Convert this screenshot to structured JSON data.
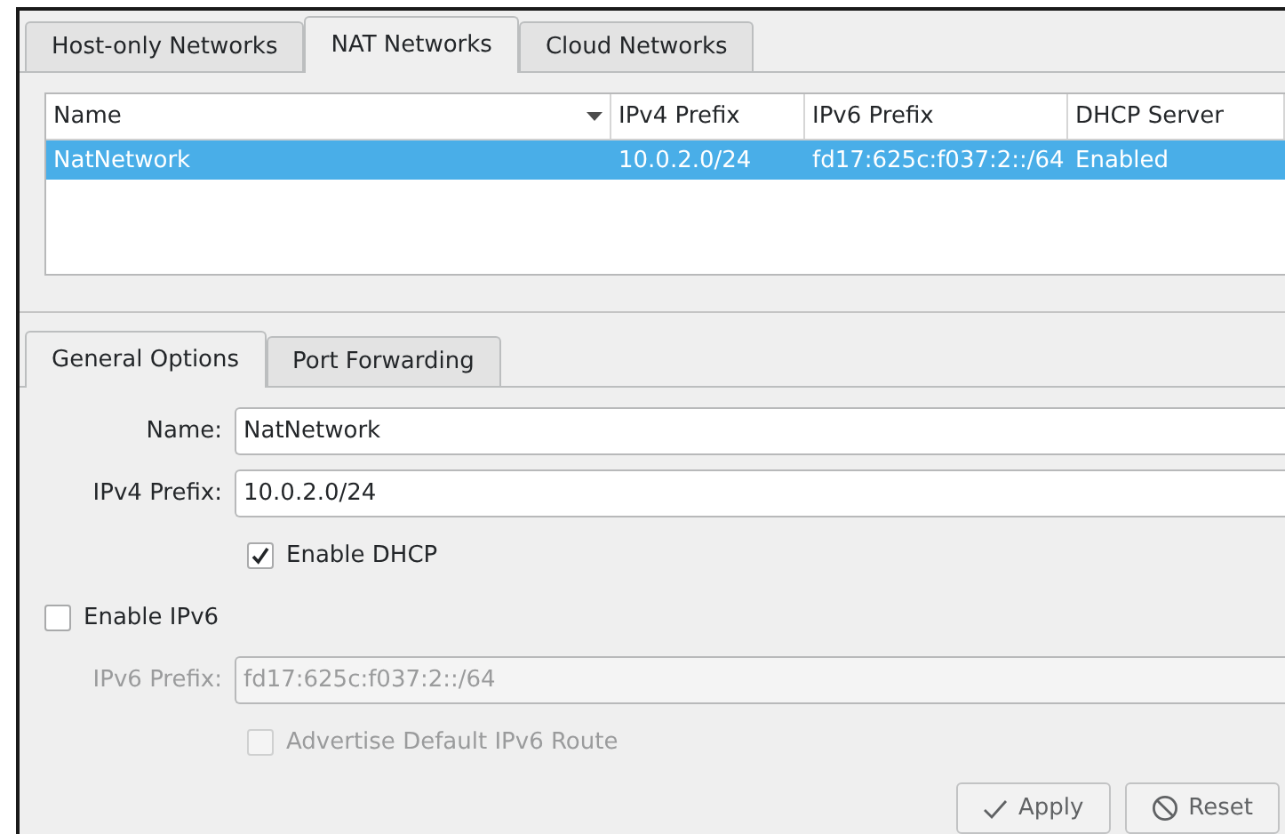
{
  "top_tabs": [
    {
      "label": "Host-only Networks",
      "selected": false
    },
    {
      "label": "NAT Networks",
      "selected": true
    },
    {
      "label": "Cloud Networks",
      "selected": false
    }
  ],
  "table": {
    "columns": [
      {
        "label": "Name",
        "sorted": true
      },
      {
        "label": "IPv4 Prefix",
        "sorted": false
      },
      {
        "label": "IPv6 Prefix",
        "sorted": false
      },
      {
        "label": "DHCP Server",
        "sorted": false
      }
    ],
    "rows": [
      {
        "cells": [
          "NatNetwork",
          "10.0.2.0/24",
          "fd17:625c:f037:2::/64",
          "Enabled"
        ],
        "selected": true
      }
    ]
  },
  "detail_tabs": [
    {
      "label": "General Options",
      "selected": true
    },
    {
      "label": "Port Forwarding",
      "selected": false
    }
  ],
  "form": {
    "name": {
      "label": "Name:",
      "value": "NatNetwork",
      "disabled": false
    },
    "ipv4_prefix": {
      "label": "IPv4 Prefix:",
      "value": "10.0.2.0/24",
      "disabled": false
    },
    "enable_dhcp": {
      "label": "Enable DHCP",
      "checked": true,
      "disabled": false
    },
    "enable_ipv6": {
      "label": "Enable IPv6",
      "checked": false,
      "disabled": false
    },
    "ipv6_prefix": {
      "label": "IPv6 Prefix:",
      "value": "fd17:625c:f037:2::/64",
      "disabled": true
    },
    "advertise_route": {
      "label": "Advertise Default IPv6 Route",
      "checked": false,
      "disabled": true
    }
  },
  "buttons": [
    {
      "label": "Apply",
      "kind": "check"
    },
    {
      "label": "Reset",
      "kind": "cancel"
    }
  ]
}
